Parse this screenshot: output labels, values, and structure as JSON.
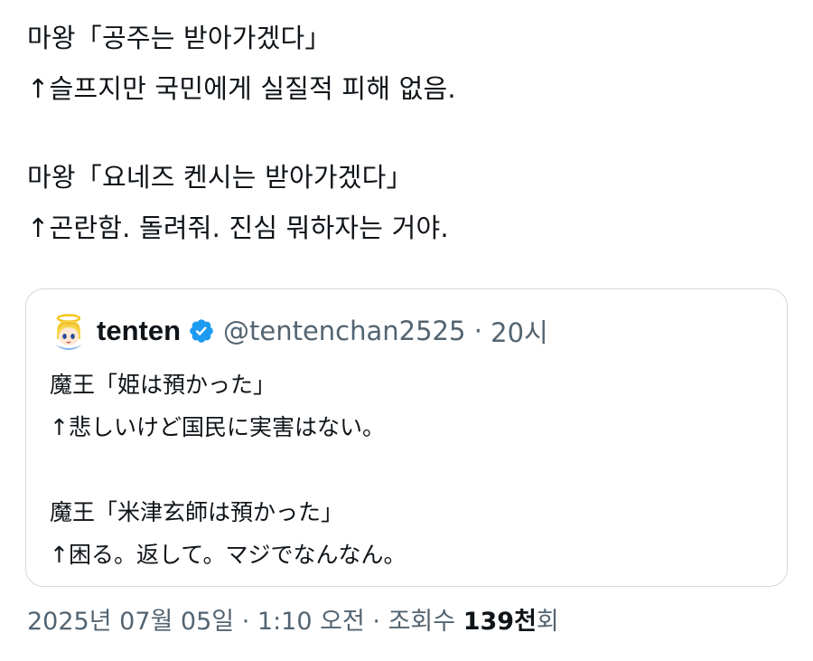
{
  "tweet": {
    "lines": [
      "마왕「공주는 받아가겠다」",
      "↑슬프지만 국민에게 실질적 피해 없음.",
      "",
      "마왕「요네즈 켄시는 받아가겠다」",
      "↑곤란함. 돌려줘. 진심 뭐하자는 거야."
    ]
  },
  "quote": {
    "author_name": "tenten",
    "verified_icon": "verified-badge-icon",
    "handle": "@tentenchan2525",
    "separator": "·",
    "time": "20시",
    "lines": [
      "魔王「姫は預かった」",
      "↑悲しいけど国民に実害はない。",
      "",
      "魔王「米津玄師は預かった」",
      "↑困る。返して。マジでなんなん。"
    ]
  },
  "footer": {
    "date": "2025년 07월 05일",
    "separator": "·",
    "time": "1:10 오전",
    "views_label": "조회수",
    "views_count": "139천",
    "views_unit": "회"
  },
  "colors": {
    "text": "#0f1419",
    "secondary_text": "#536471",
    "border": "#cfd9de",
    "verified_blue": "#1d9bf0"
  }
}
